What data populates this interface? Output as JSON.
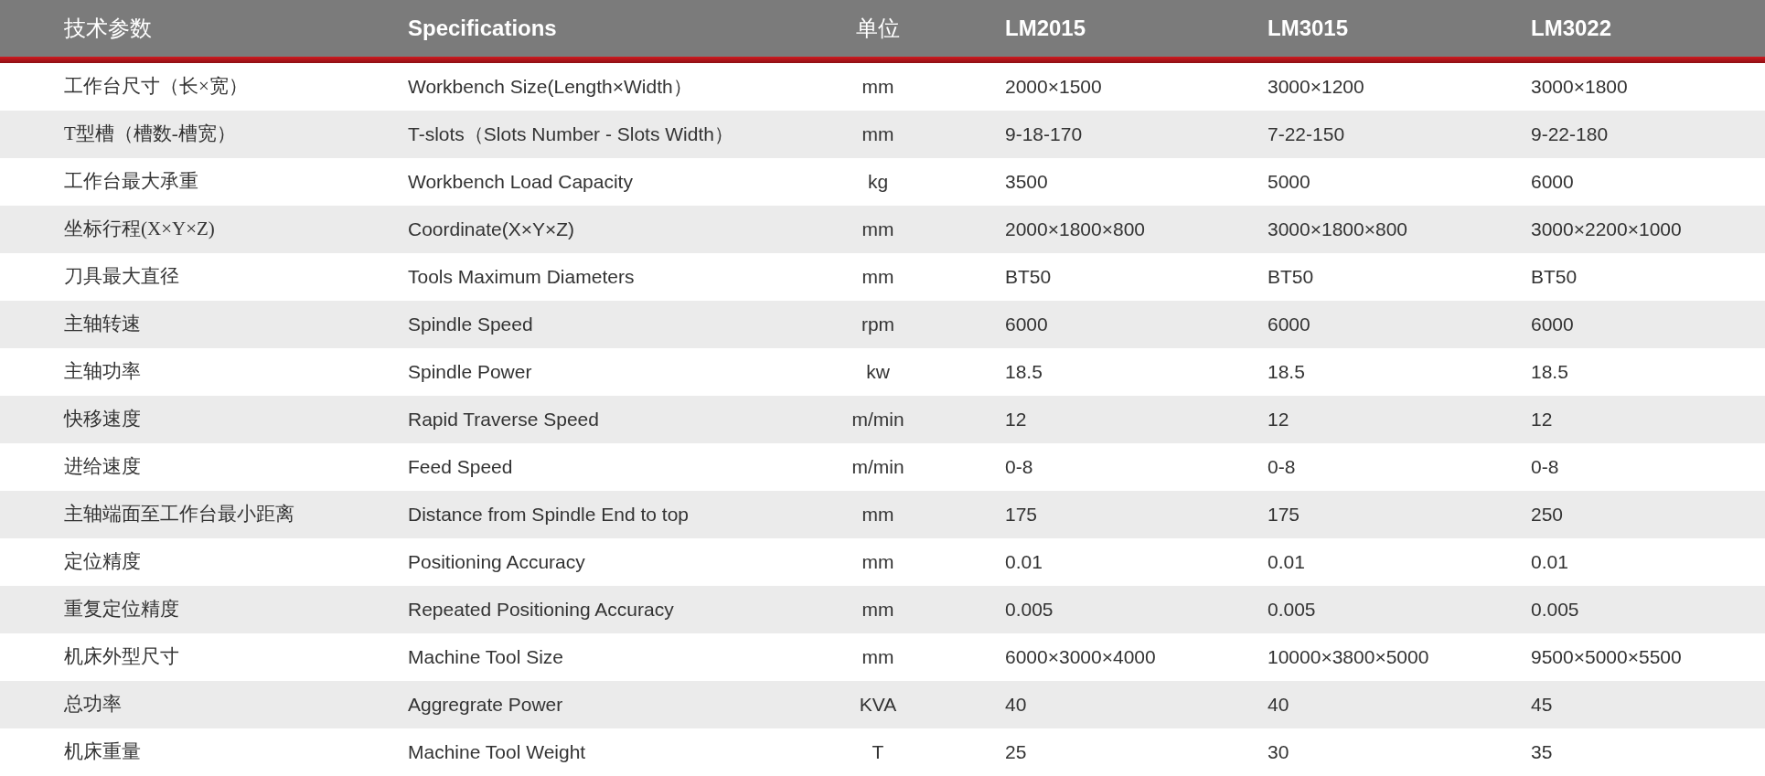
{
  "table": {
    "columns": [
      "技术参数",
      "Specifications",
      "单位",
      "LM2015",
      "LM3015",
      "LM3022"
    ],
    "rows": [
      {
        "cells": [
          "工作台尺寸（长×宽）",
          "Workbench Size(Length×Width）",
          "mm",
          "2000×1500",
          "3000×1200",
          "3000×1800"
        ]
      },
      {
        "cells": [
          "T型槽（槽数-槽宽）",
          "T-slots（Slots Number - Slots Width）",
          "mm",
          "9-18-170",
          "7-22-150",
          "9-22-180"
        ]
      },
      {
        "cells": [
          "工作台最大承重",
          "Workbench Load Capacity",
          "kg",
          "3500",
          "5000",
          "6000"
        ]
      },
      {
        "cells": [
          "坐标行程(X×Y×Z)",
          "Coordinate(X×Y×Z)",
          "mm",
          "2000×1800×800",
          "3000×1800×800",
          "3000×2200×1000"
        ]
      },
      {
        "cells": [
          "刀具最大直径",
          "Tools Maximum Diameters",
          "mm",
          "BT50",
          "BT50",
          "BT50"
        ]
      },
      {
        "cells": [
          "主轴转速",
          "Spindle Speed",
          "rpm",
          "6000",
          "6000",
          "6000"
        ]
      },
      {
        "cells": [
          "主轴功率",
          "Spindle Power",
          "kw",
          "18.5",
          "18.5",
          "18.5"
        ]
      },
      {
        "cells": [
          "快移速度",
          "Rapid Traverse Speed",
          "m/min",
          "12",
          "12",
          "12"
        ]
      },
      {
        "cells": [
          "进给速度",
          "Feed Speed",
          "m/min",
          "0-8",
          "0-8",
          "0-8"
        ]
      },
      {
        "cells": [
          "主轴端面至工作台最小距离",
          "Distance from Spindle End to top",
          "mm",
          "175",
          "175",
          "250"
        ]
      },
      {
        "cells": [
          "定位精度",
          "Positioning Accuracy",
          "mm",
          "0.01",
          "0.01",
          "0.01"
        ]
      },
      {
        "cells": [
          "重复定位精度",
          "Repeated Positioning Accuracy",
          "mm",
          "0.005",
          "0.005",
          "0.005"
        ]
      },
      {
        "cells": [
          "机床外型尺寸",
          "Machine Tool Size",
          "mm",
          "6000×3000×4000",
          "10000×3800×5000",
          "9500×5000×5500"
        ]
      },
      {
        "cells": [
          "总功率",
          "Aggregrate Power",
          "KVA",
          "40",
          "40",
          "45"
        ]
      },
      {
        "cells": [
          "机床重量",
          "Machine Tool Weight",
          "T",
          "25",
          "30",
          "35"
        ]
      }
    ]
  }
}
